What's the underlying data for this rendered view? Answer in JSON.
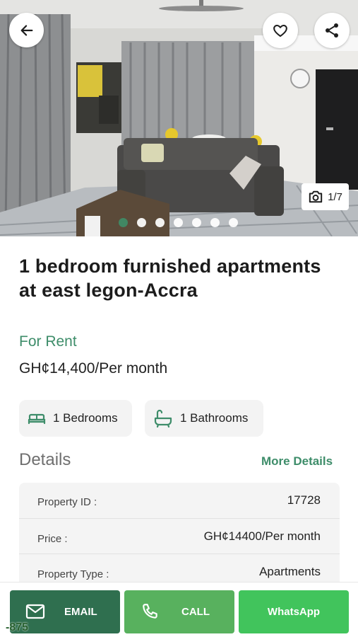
{
  "gallery": {
    "photo_counter": "1/7",
    "total_dots": 7,
    "active_dot": 0,
    "icons": {
      "back": "arrow-left-icon",
      "favorite": "heart-outline-icon",
      "share": "share-icon",
      "camera": "camera-icon"
    }
  },
  "listing": {
    "title": "1 bedroom furnished apartments at east legon-Accra",
    "type": "For Rent",
    "price": "GH¢14,400/Per month"
  },
  "features": {
    "bedrooms": "1 Bedrooms",
    "bathrooms": "1 Bathrooms"
  },
  "details": {
    "heading": "Details",
    "more_link": "More Details",
    "rows": [
      {
        "label": "Property ID :",
        "value": "17728"
      },
      {
        "label": "Price :",
        "value": "GH¢14400/Per month"
      },
      {
        "label": "Property Type :",
        "value": "Apartments"
      }
    ]
  },
  "actions": {
    "email": "EMAIL",
    "call": "CALL",
    "whatsapp": "WhatsApp"
  },
  "overlay_code": "-875",
  "colors": {
    "accent_green": "#3e8d6a",
    "email_button": "#2f6f4f",
    "call_button": "#58b15e",
    "whatsapp_button": "#41c45c"
  }
}
